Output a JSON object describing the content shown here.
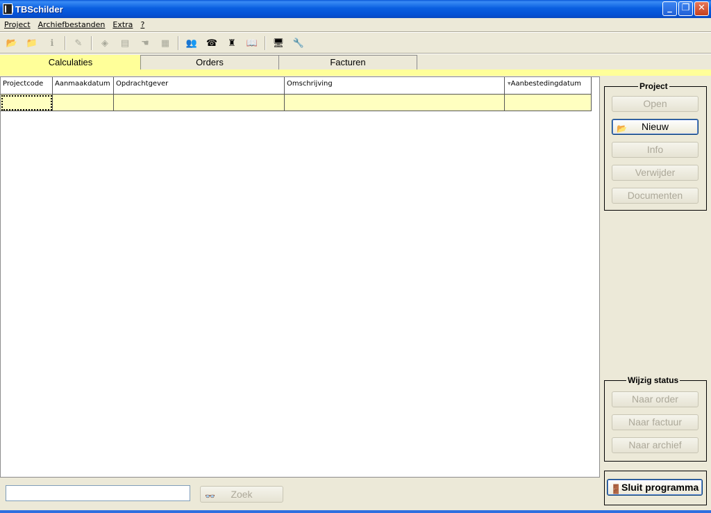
{
  "window": {
    "title": "TBSchilder"
  },
  "menu": [
    "Project",
    "Archiefbestanden",
    "Extra",
    "?"
  ],
  "toolbar": {
    "groups": [
      [
        {
          "icon": "open-folder-icon",
          "glyph": "📂",
          "enabled": true
        },
        {
          "icon": "folder-icon",
          "glyph": "📁",
          "enabled": false
        },
        {
          "icon": "info-icon",
          "glyph": "ℹ",
          "enabled": false
        }
      ],
      [
        {
          "icon": "edit-document-icon",
          "glyph": "✎",
          "enabled": false
        }
      ],
      [
        {
          "icon": "paint-icon",
          "glyph": "◈",
          "enabled": false
        },
        {
          "icon": "document-icon",
          "glyph": "▤",
          "enabled": false
        },
        {
          "icon": "hand-icon",
          "glyph": "☚",
          "enabled": false
        },
        {
          "icon": "print-icon",
          "glyph": "▦",
          "enabled": false
        }
      ],
      [
        {
          "icon": "users-icon",
          "glyph": "👥",
          "enabled": true
        },
        {
          "icon": "contact-card-icon",
          "glyph": "☎",
          "enabled": true
        },
        {
          "icon": "paint-bottle-icon",
          "glyph": "♜",
          "enabled": true
        },
        {
          "icon": "book-icon",
          "glyph": "📖",
          "enabled": true
        }
      ],
      [
        {
          "icon": "monitor-icon",
          "glyph": "🖥",
          "enabled": true
        },
        {
          "icon": "tools-icon",
          "glyph": "🔧",
          "enabled": true
        }
      ]
    ]
  },
  "tabs": [
    {
      "label": "Calculaties",
      "active": true
    },
    {
      "label": "Orders",
      "active": false
    },
    {
      "label": "Facturen",
      "active": false
    }
  ],
  "grid": {
    "columns": [
      "Projectcode",
      "Aanmaakdatum",
      "Opdrachtgever",
      "Omschrijving",
      "Aanbestedingdatum"
    ],
    "sorted_column": "Aanbestedingdatum",
    "sort_indicator": "▼",
    "rows": [
      [
        "",
        "",
        "",
        "",
        ""
      ]
    ]
  },
  "project_panel": {
    "title": "Project",
    "buttons": [
      {
        "label": "Open",
        "enabled": false
      },
      {
        "label": "Nieuw",
        "enabled": true
      },
      {
        "label": "Info",
        "enabled": false
      },
      {
        "label": "Verwijder",
        "enabled": false
      },
      {
        "label": "Documenten",
        "enabled": false
      }
    ]
  },
  "status_panel": {
    "title": "Wijzig status",
    "buttons": [
      {
        "label": "Naar order",
        "enabled": false
      },
      {
        "label": "Naar factuur",
        "enabled": false
      },
      {
        "label": "Naar archief",
        "enabled": false
      }
    ]
  },
  "close_button": {
    "label": "Sluit programma"
  },
  "search": {
    "value": "",
    "button_label": "Zoek"
  },
  "colors": {
    "accent": "#ffff99",
    "row": "#ffffc0",
    "titlebar": "#0a5fe0"
  }
}
